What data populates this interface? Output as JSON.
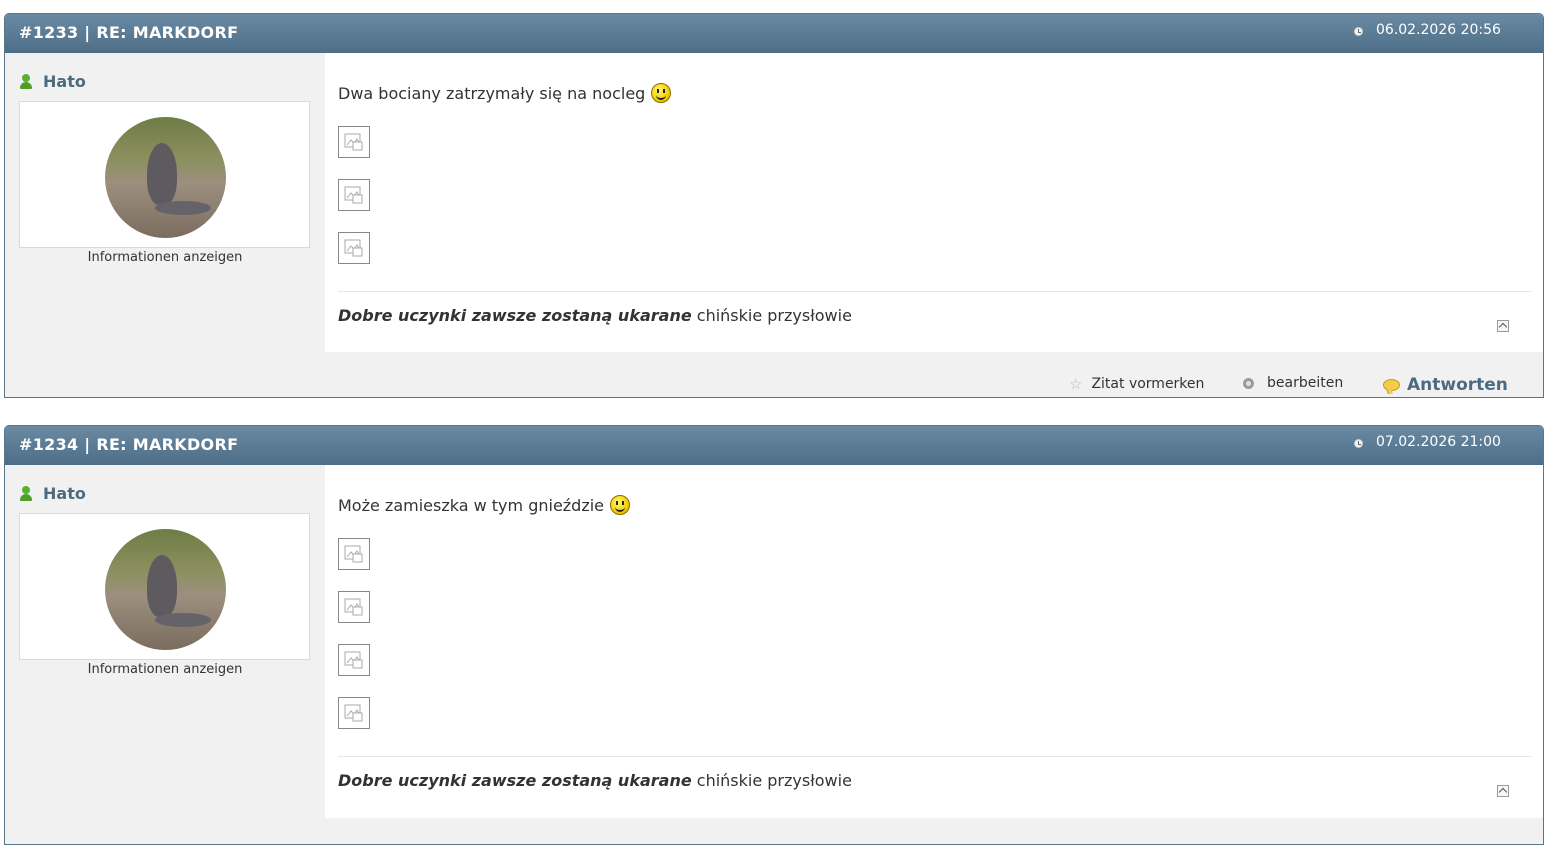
{
  "posts": [
    {
      "title": "#1233 | RE: MARKDORF",
      "date": "06.02.2026 20:56",
      "author": "Hato",
      "info_link": "Informationen anzeigen",
      "text": "Dwa bociany zatrzymały się na nocleg",
      "image_count": 3,
      "signature_bold": "Dobre uczynki zawsze zostaną ukarane",
      "signature_rest": " chińskie przysłowie",
      "actions": {
        "quote": "Zitat vormerken",
        "edit": "bearbeiten",
        "reply": "Antworten"
      }
    },
    {
      "title": "#1234 | RE: MARKDORF",
      "date": "07.02.2026 21:00",
      "author": "Hato",
      "info_link": "Informationen anzeigen",
      "text": "Może zamieszka w tym gnieździe",
      "image_count": 4,
      "signature_bold": "Dobre uczynki zawsze zostaną ukarane",
      "signature_rest": " chińskie przysłowie"
    }
  ],
  "colors": {
    "header": "#5a7a93",
    "username": "#4d6b80",
    "user_icon": "#4f9e28"
  },
  "icons": [
    "clock-icon",
    "user-icon",
    "smiley-icon",
    "image-placeholder-icon",
    "scroll-top-icon",
    "star-icon",
    "gear-icon",
    "speech-bubble-icon"
  ]
}
